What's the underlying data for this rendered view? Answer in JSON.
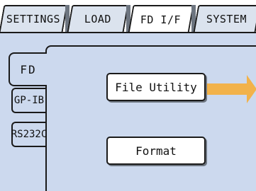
{
  "top_tabs": [
    {
      "label": "SETTINGS",
      "selected": false
    },
    {
      "label": "LOAD",
      "selected": false
    },
    {
      "label": "FD I/F",
      "selected": true
    },
    {
      "label": "SYSTEM",
      "selected": false
    }
  ],
  "side_tabs": [
    {
      "label": "FD",
      "selected": true
    },
    {
      "label": "GP-IB",
      "selected": false
    },
    {
      "label": "RS232C",
      "selected": false
    }
  ],
  "buttons": {
    "file_utility": "File Utility",
    "format": "Format"
  },
  "colors": {
    "panel": "#ccd9ee",
    "tab_inactive": "#dbe3ee",
    "button": "#ffffff",
    "arrow": "#f2b24a",
    "border": "#1a1a1a"
  },
  "icons": {
    "arrow": "arrow-right-icon"
  }
}
